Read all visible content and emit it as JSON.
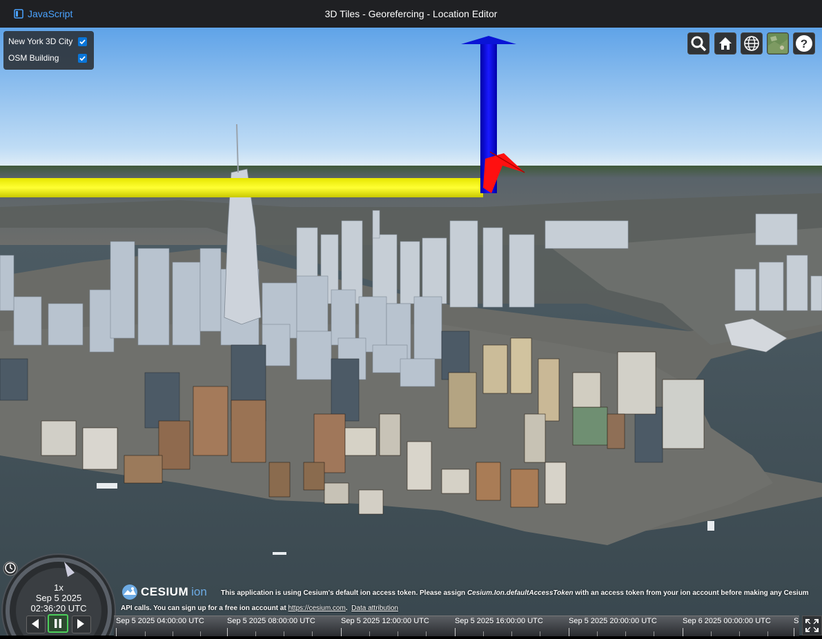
{
  "header": {
    "js_link_label": "JavaScript",
    "title": "3D Tiles - Georefercing - Location Editor"
  },
  "layers": [
    {
      "label": "New York 3D City",
      "checked": true
    },
    {
      "label": "OSM Building",
      "checked": true
    }
  ],
  "toolbar": [
    "search-icon",
    "home-icon",
    "globe-icon",
    "imagery-layer-icon",
    "help-icon"
  ],
  "animation": {
    "speed": "1x",
    "date": "Sep 5 2025",
    "time": "02:36:20 UTC"
  },
  "credits": {
    "logo_text": "CESIUM",
    "logo_suffix": "ion",
    "line1_prefix": "This application is using Cesium's default ion access token. Please assign ",
    "line1_code": "Cesium.Ion.defaultAccessToken",
    "line1_suffix": " with an access token from your ion account before making any Cesium",
    "line2_prefix": "API calls. You can sign up for a free ion account at ",
    "line2_link": "https://cesium.com",
    "line2_after": ".",
    "data_attribution": "Data attribution"
  },
  "timeline": {
    "labels": [
      "Sep 5 2025 04:00:00 UTC",
      "Sep 5 2025 08:00:00 UTC",
      "Sep 5 2025 12:00:00 UTC",
      "Sep 5 2025 16:00:00 UTC",
      "Sep 5 2025 20:00:00 UTC",
      "Sep 6 2025 00:00:00 UTC",
      "S"
    ]
  }
}
